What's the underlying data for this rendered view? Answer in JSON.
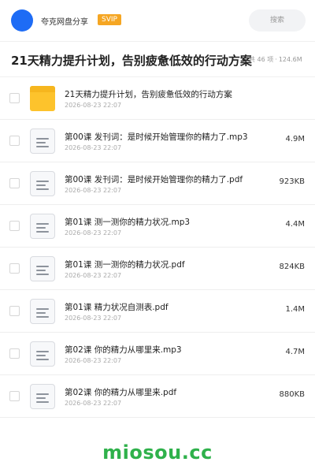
{
  "header": {
    "owner_name": "夸克网盘分享",
    "badge": "SVIP",
    "search_placeholder": "搜索"
  },
  "share": {
    "title": "21天精力提升计划，告别疲惫低效的行动方案",
    "item_count": "共 46 项",
    "separator": "·",
    "total_size": "124.6M"
  },
  "files": [
    {
      "name": "21天精力提升计划，告别疲惫低效的行动方案",
      "date": "2026-08-23 22:07",
      "size": "",
      "type": "folder-icon"
    },
    {
      "name": "第00课 发刊词：是时候开始管理你的精力了.mp3",
      "date": "2026-08-23 22:07",
      "size": "4.9M",
      "type": "document-icon"
    },
    {
      "name": "第00课 发刊词：是时候开始管理你的精力了.pdf",
      "date": "2026-08-23 22:07",
      "size": "923KB",
      "type": "document-icon"
    },
    {
      "name": "第01课 测一测你的精力状况.mp3",
      "date": "2026-08-23 22:07",
      "size": "4.4M",
      "type": "document-icon"
    },
    {
      "name": "第01课 测一测你的精力状况.pdf",
      "date": "2026-08-23 22:07",
      "size": "824KB",
      "type": "document-icon"
    },
    {
      "name": "第01课 精力状况自测表.pdf",
      "date": "2026-08-23 22:07",
      "size": "1.4M",
      "type": "document-icon"
    },
    {
      "name": "第02课 你的精力从哪里来.mp3",
      "date": "2026-08-23 22:07",
      "size": "4.7M",
      "type": "document-icon"
    },
    {
      "name": "第02课 你的精力从哪里来.pdf",
      "date": "2026-08-23 22:07",
      "size": "880KB",
      "type": "document-icon"
    }
  ],
  "watermark": "miosou.cc",
  "colors": {
    "accent_blue": "#1e6cf5",
    "svip_orange": "#f5a623",
    "folder_yellow": "#fdc32c",
    "watermark_green": "#2fb14b"
  }
}
